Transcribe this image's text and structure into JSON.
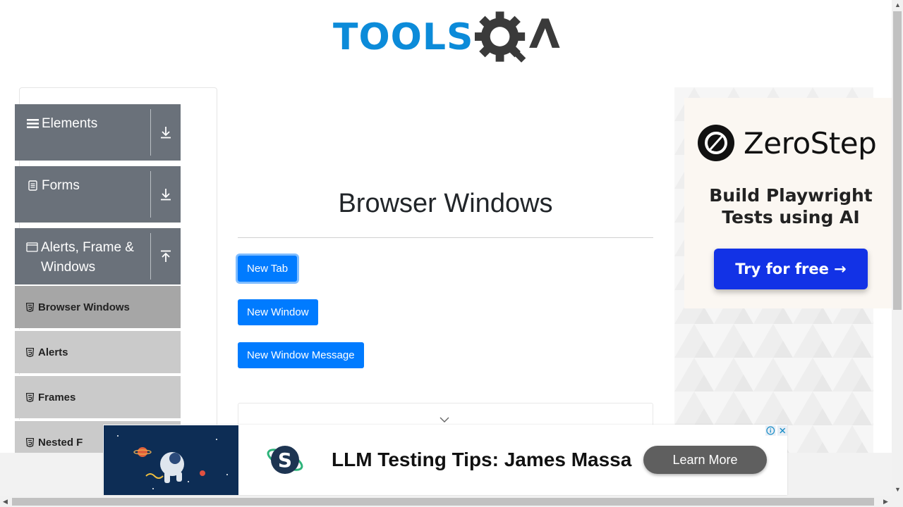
{
  "header": {
    "logo_text_tools": "TOOLS",
    "logo_text_qa": "QA",
    "brand_blue": "#0c8bd9",
    "brand_dark": "#3a3a3a"
  },
  "sidebar": {
    "groups": [
      {
        "label": "Elements",
        "icon": "hamburger-icon",
        "arrow": "download-arrow-icon"
      },
      {
        "label": "Forms",
        "icon": "document-icon",
        "arrow": "download-arrow-icon"
      },
      {
        "label": "Alerts, Frame & Windows",
        "icon": "window-icon",
        "arrow": "upload-arrow-icon"
      }
    ],
    "items": [
      {
        "label": "Browser Windows",
        "active": true
      },
      {
        "label": "Alerts",
        "active": false
      },
      {
        "label": "Frames",
        "active": false
      },
      {
        "label": "Nested F",
        "active": false
      }
    ]
  },
  "main": {
    "title": "Browser Windows",
    "buttons": {
      "new_tab": "New Tab",
      "new_window": "New Window",
      "new_window_message": "New Window Message"
    },
    "accent": "#007bff"
  },
  "ad_right": {
    "brand": "ZeroStep",
    "headline_line1": "Build Playwright",
    "headline_line2": "Tests using AI",
    "cta": "Try for free →",
    "cta_color": "#1232e6"
  },
  "ad_bottom": {
    "headline": "LLM Testing Tips: James Massa",
    "cta": "Learn More",
    "logo_letter": "S"
  }
}
